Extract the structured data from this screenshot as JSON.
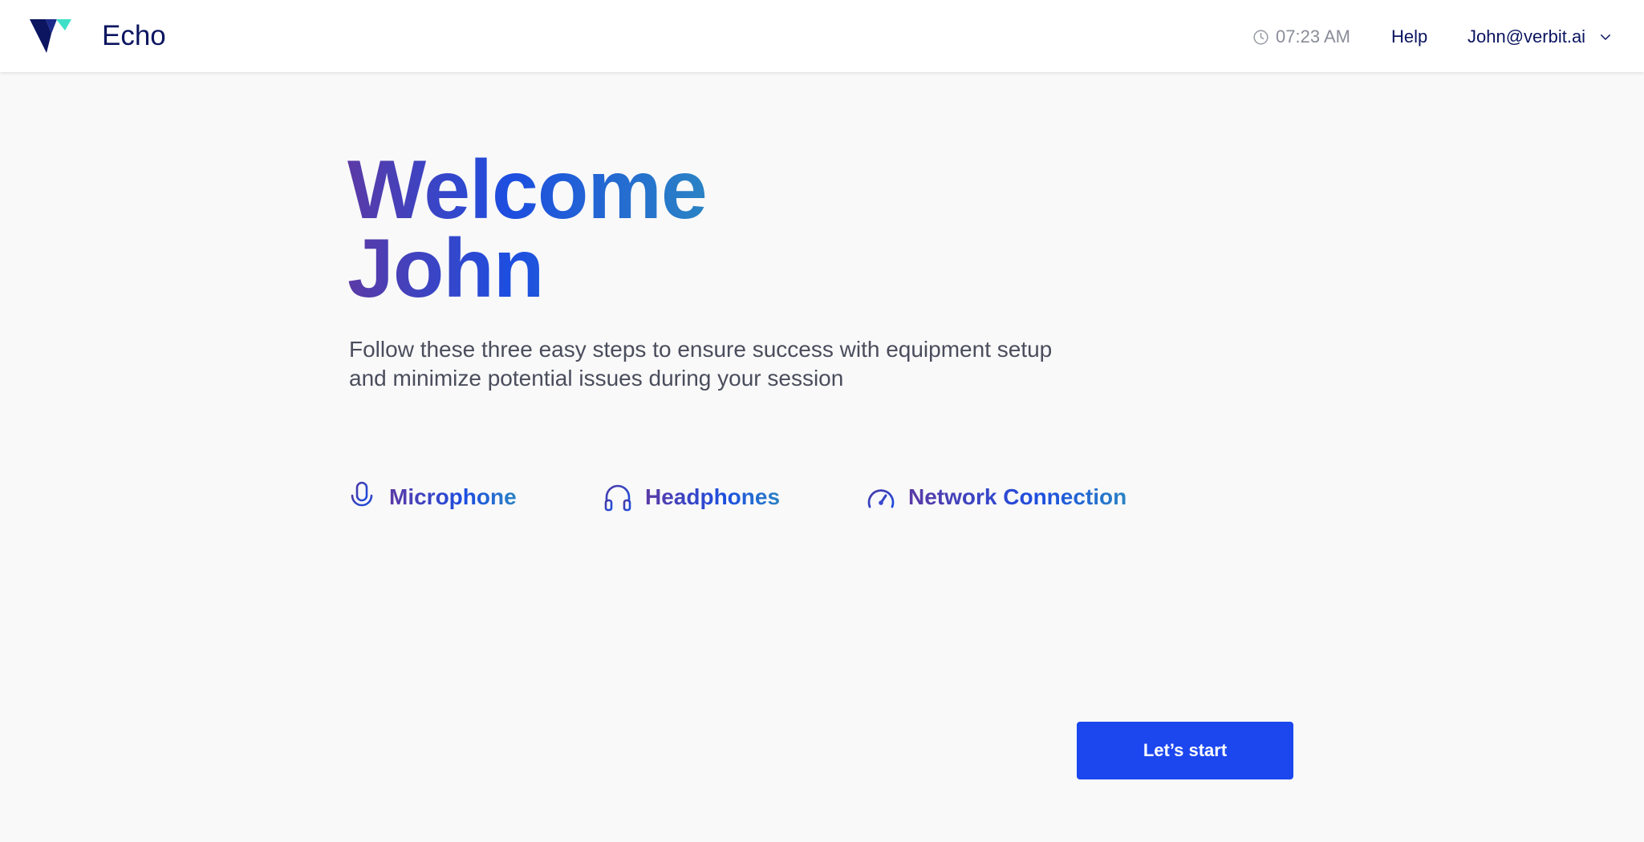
{
  "header": {
    "app_name": "Echo",
    "logo_icon": "verbit-v-logo",
    "time": "07:23 AM",
    "time_icon": "clock-icon",
    "help_label": "Help",
    "user_email": "John@verbit.ai",
    "user_menu_icon": "chevron-down-icon"
  },
  "main": {
    "title_line1": "Welcome",
    "title_line2": "John",
    "subtitle_line1": "Follow these three easy steps to ensure success with equipment setup",
    "subtitle_line2": "and minimize potential issues during your session",
    "steps": [
      {
        "icon": "microphone-icon",
        "label": "Microphone"
      },
      {
        "icon": "headphones-icon",
        "label": "Headphones"
      },
      {
        "icon": "speedometer-icon",
        "label": "Network Connection"
      }
    ],
    "start_button_label": "Let’s start"
  },
  "colors": {
    "primary": "#1c47ef",
    "navy_text": "#0b1560",
    "gradient_start": "#5b3aa6",
    "gradient_mid": "#1d4ee0",
    "gradient_end": "#2a83c4",
    "logo_teal": "#3ee0c8",
    "page_background": "#f9f9f9"
  }
}
